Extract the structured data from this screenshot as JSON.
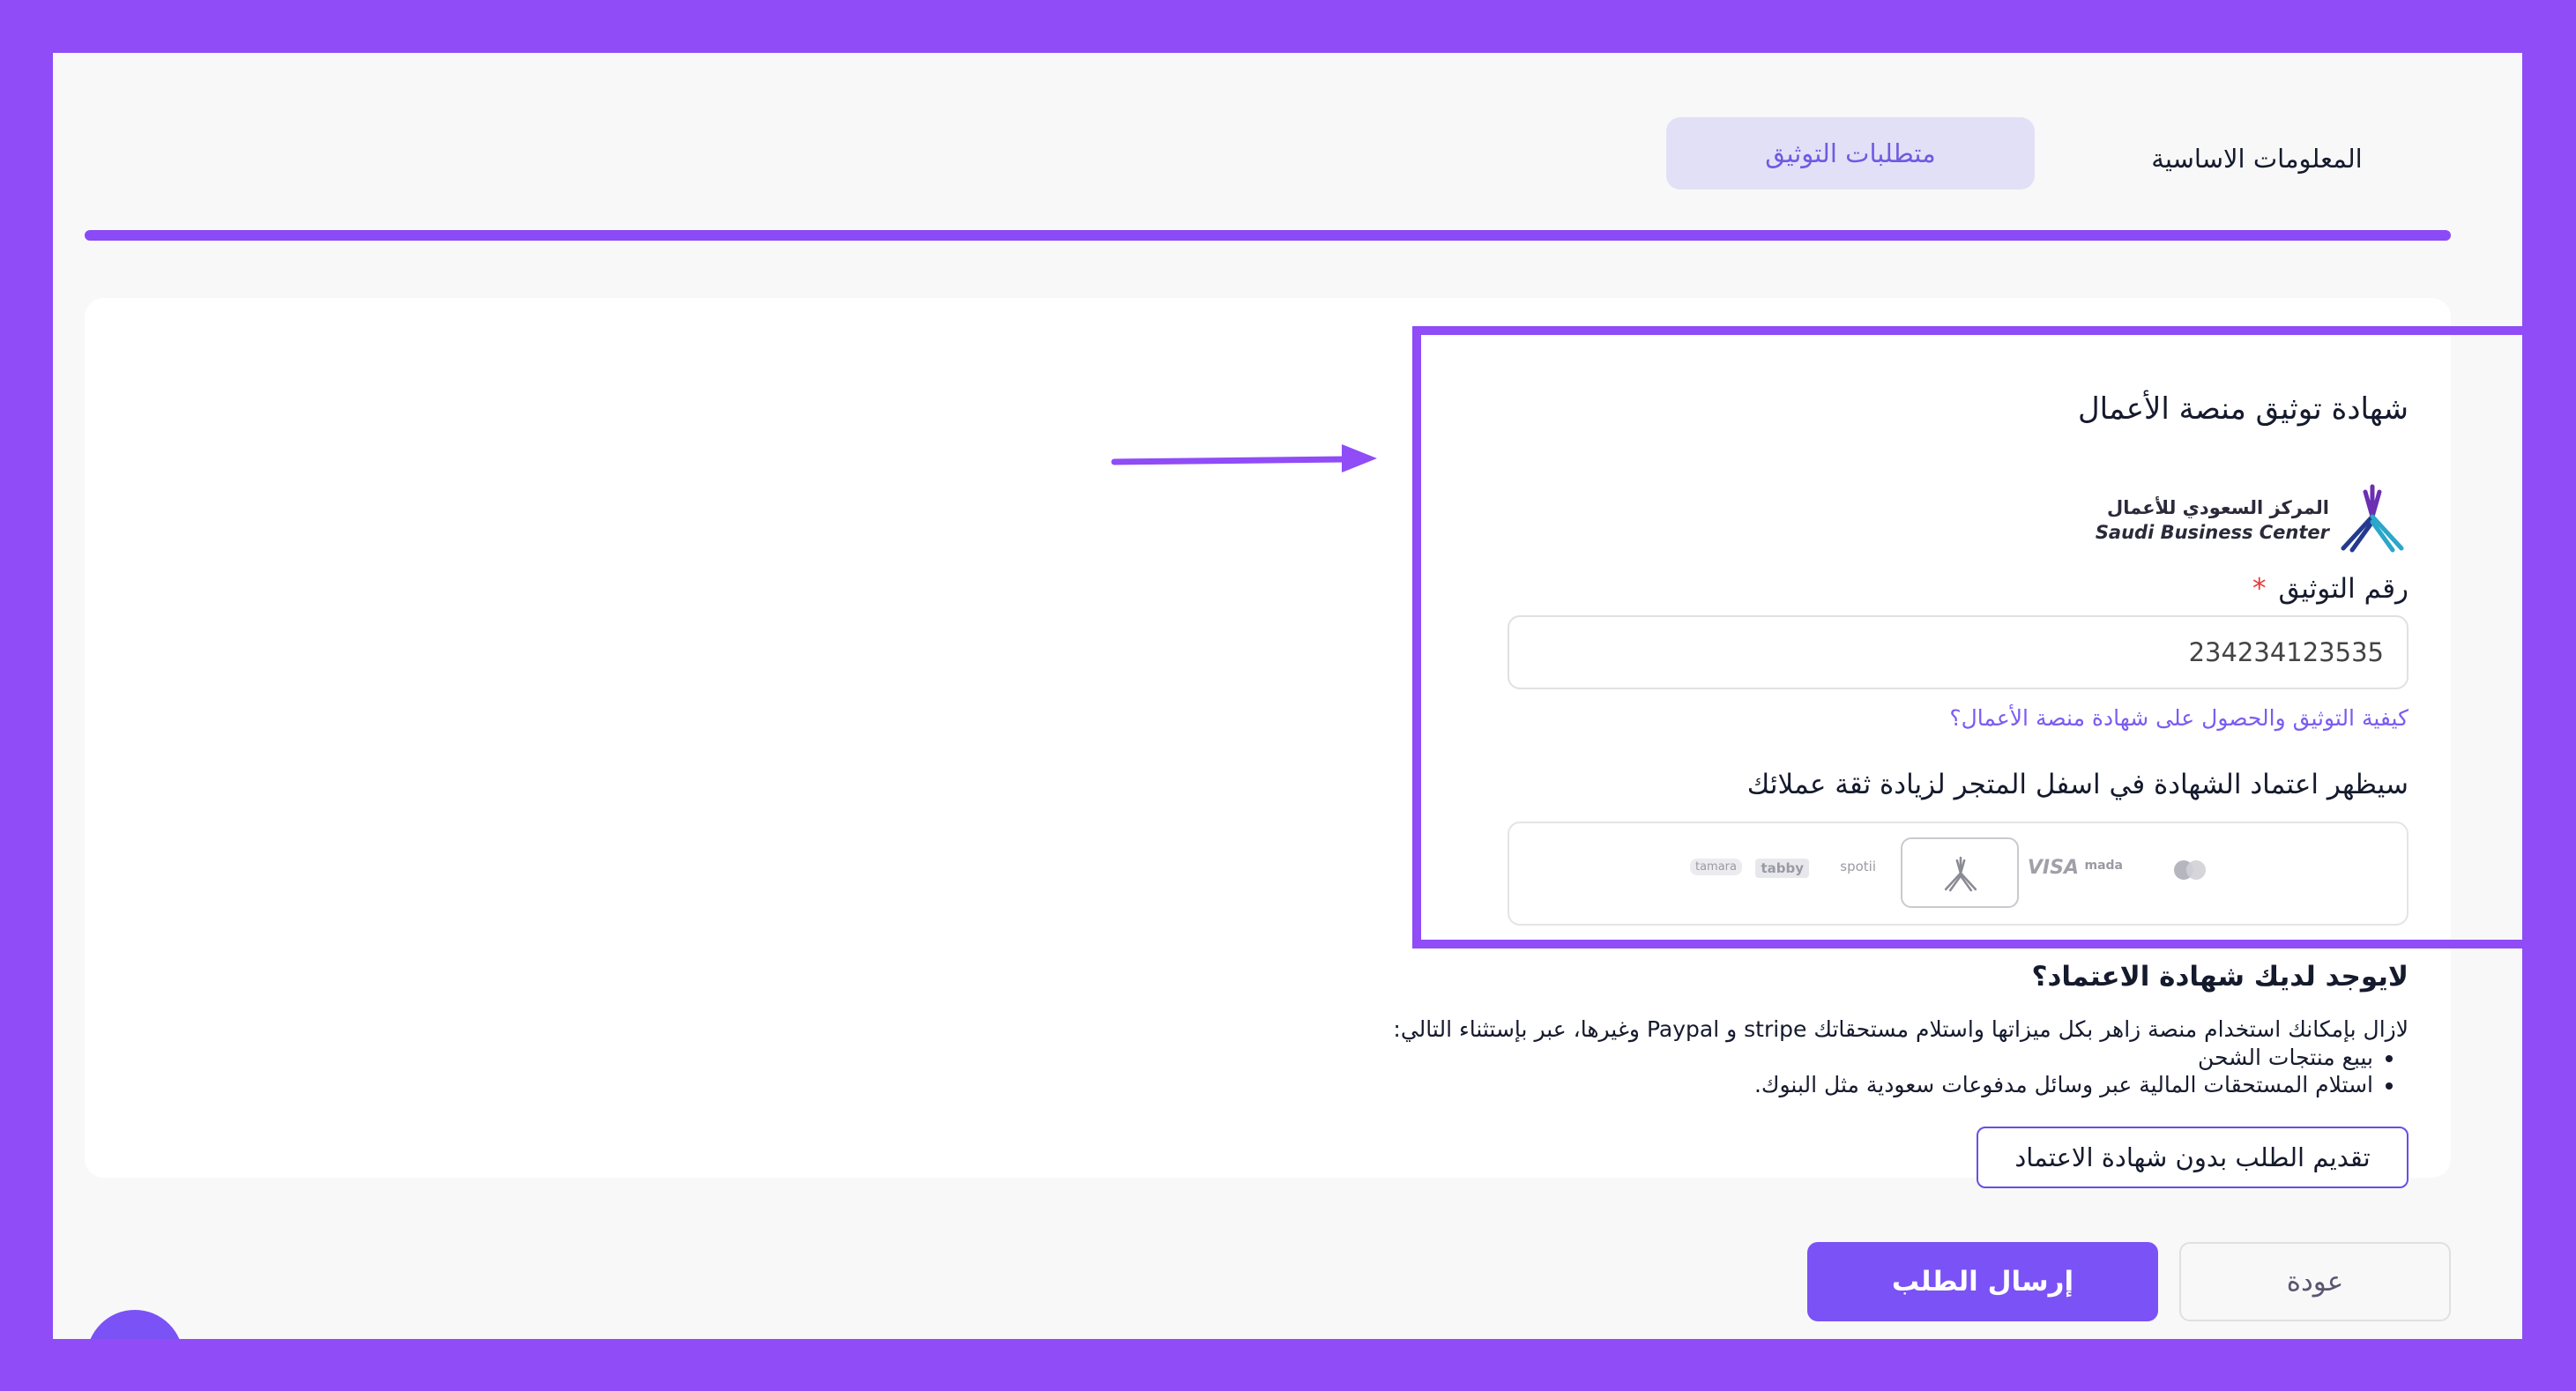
{
  "tabs": {
    "basic_info": "المعلومات الاساسية",
    "verification_requirements": "متطلبات التوثيق"
  },
  "certificate": {
    "heading": "شهادة توثيق منصة الأعمال",
    "logo_ar": "المركز السعودي للأعمال",
    "logo_en": "Saudi Business Center",
    "number_label": "رقم التوثيق",
    "required_mark": "*",
    "number_value": "234234123535",
    "help_link": "كيفية التوثيق والحصول على شهادة منصة الأعمال؟",
    "notice": "سيظهر اعتماد الشهادة في اسفل المتجر لزيادة ثقة عملائك"
  },
  "payment_logos": [
    "mastercard",
    "mada",
    "VISA",
    "spotii",
    "tabby",
    "tamara"
  ],
  "no_certificate": {
    "title": "لايوجد لديك شهادة الاعتماد؟",
    "description": "لازال بإمكانك استخدام منصة زاهر بكل ميزاتها واستلام مستحقاتك stripe و Paypal وغيرها، عبر بإستثناء التالي:",
    "exceptions": [
      "بيبع منتجات الشحن",
      "استلام المستحقات المالية عبر وسائل مدفوعات سعودية مثل البنوك."
    ],
    "submit_without_label": "تقديم الطلب بدون شهادة الاعتماد"
  },
  "footer": {
    "submit_label": "إرسال الطلب",
    "back_label": "عودة"
  },
  "colors": {
    "accent": "#8f4cf7",
    "primary_button": "#7b52f5",
    "active_tab_bg": "#e2e0f7",
    "link": "#7b5cf2",
    "required": "#e23b3b"
  }
}
